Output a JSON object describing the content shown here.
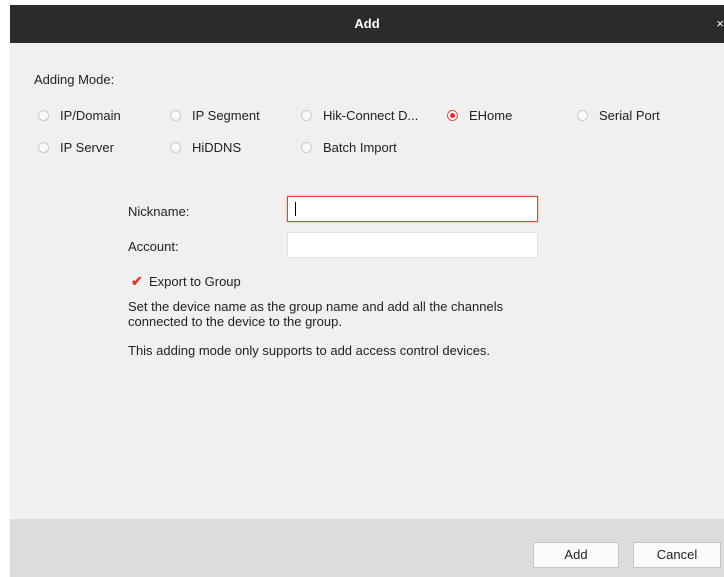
{
  "window": {
    "title": "Add",
    "close_glyph": "×"
  },
  "adding_mode": {
    "label": "Adding Mode:",
    "options": [
      {
        "label": "IP/Domain",
        "selected": false
      },
      {
        "label": "IP Segment",
        "selected": false
      },
      {
        "label": "Hik-Connect D...",
        "selected": false
      },
      {
        "label": "EHome",
        "selected": true
      },
      {
        "label": "Serial Port",
        "selected": false
      },
      {
        "label": "IP Server",
        "selected": false
      },
      {
        "label": "HiDDNS",
        "selected": false
      },
      {
        "label": "Batch Import",
        "selected": false
      }
    ]
  },
  "form": {
    "nickname_label": "Nickname:",
    "nickname_value": "",
    "account_label": "Account:",
    "account_value": "",
    "export_label": "Export to Group",
    "export_checked": true,
    "description": "Set the device name as the group name and add all the channels connected to the device to the group.",
    "note": "This adding mode only supports to add access control devices."
  },
  "buttons": {
    "add": "Add",
    "cancel": "Cancel"
  },
  "colors": {
    "accent": "#e0302a",
    "titlebar": "#2b2b2b",
    "dialog_bg": "#f0f0f0",
    "footer_bg": "#dcdcdc"
  }
}
